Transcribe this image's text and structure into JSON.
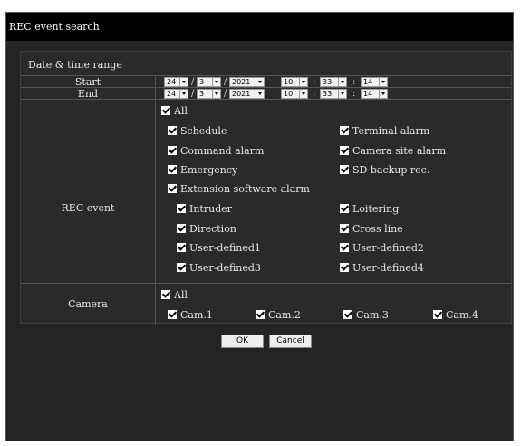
{
  "window": {
    "title": "REC event search"
  },
  "date_time": {
    "title": "Date & time range",
    "start": {
      "label": "Start",
      "year": "2021",
      "month": "3",
      "day": "24",
      "hour": "10",
      "minute": "33",
      "second": "14"
    },
    "end": {
      "label": "End",
      "year": "2021",
      "month": "3",
      "day": "24",
      "hour": "10",
      "minute": "33",
      "second": "14"
    }
  },
  "rec_event": {
    "label": "REC event",
    "all": "All",
    "schedule": "Schedule",
    "terminal_alarm": "Terminal alarm",
    "command_alarm": "Command alarm",
    "camera_site_alarm": "Camera site alarm",
    "emergency": "Emergency",
    "sd_backup": "SD backup rec.",
    "extension_software_alarm": "Extension software alarm",
    "intruder": "Intruder",
    "loitering": "Loitering",
    "direction": "Direction",
    "cross_line": "Cross line",
    "user_defined1": "User-defined1",
    "user_defined2": "User-defined2",
    "user_defined3": "User-defined3",
    "user_defined4": "User-defined4"
  },
  "camera": {
    "label": "Camera",
    "all": "All",
    "cams": [
      "Cam.1",
      "Cam.2",
      "Cam.3",
      "Cam.4"
    ]
  },
  "buttons": {
    "ok": "OK",
    "cancel": "Cancel"
  }
}
